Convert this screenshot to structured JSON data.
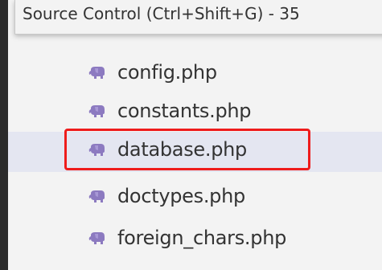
{
  "tooltip": {
    "text": "Source Control (Ctrl+Shift+G) - 35"
  },
  "files": [
    {
      "name": "config.php",
      "icon": "php-elephant-icon",
      "selected": false
    },
    {
      "name": "constants.php",
      "icon": "php-elephant-icon",
      "selected": false
    },
    {
      "name": "database.php",
      "icon": "php-elephant-icon",
      "selected": true
    },
    {
      "name": "doctypes.php",
      "icon": "php-elephant-icon",
      "selected": false
    },
    {
      "name": "foreign_chars.php",
      "icon": "php-elephant-icon",
      "selected": false
    }
  ],
  "colors": {
    "icon": "#8c7ac0",
    "highlight": "#ee1c1c",
    "selection": "#e4e6f1",
    "text": "#333333"
  }
}
